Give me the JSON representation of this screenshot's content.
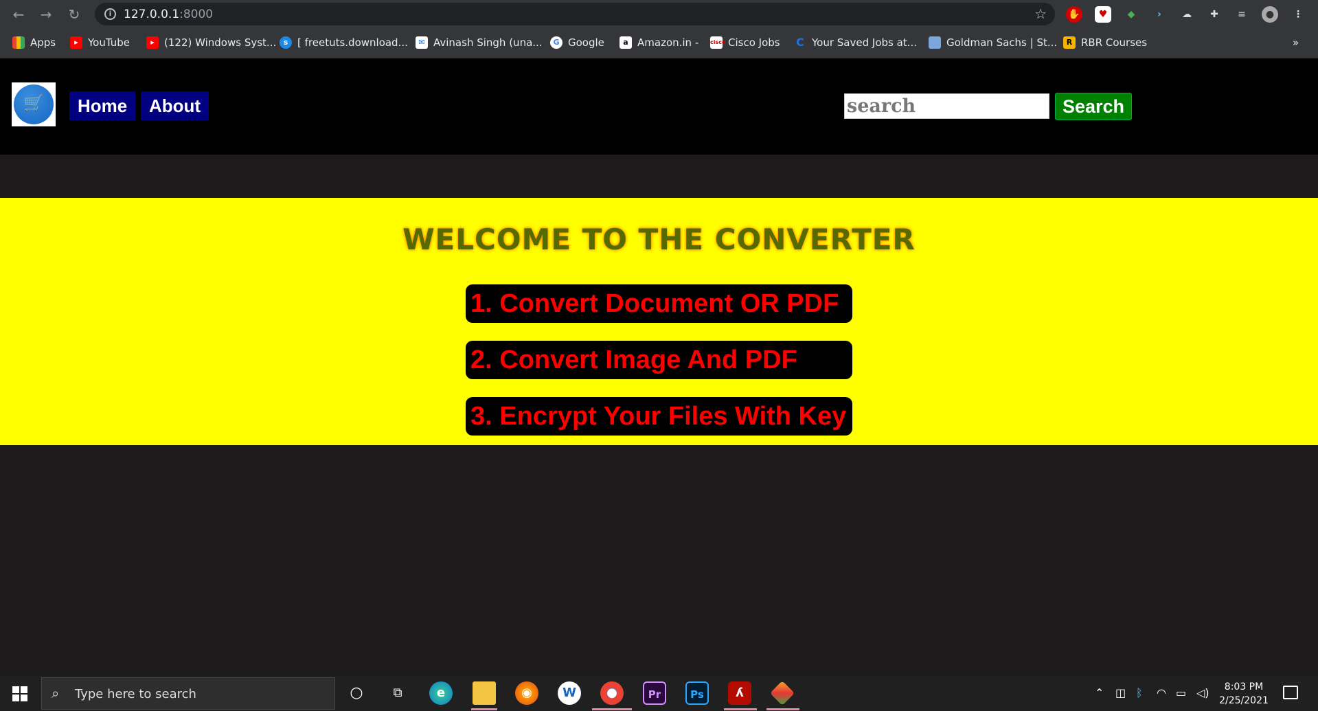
{
  "browser": {
    "url_host": "127.0.0.1",
    "url_port": ":8000",
    "bookmarks": [
      {
        "label": "Apps",
        "icon": "apps-grid-icon",
        "color": "#ea4335"
      },
      {
        "label": "YouTube",
        "icon": "youtube-icon",
        "color": "#ff0000"
      },
      {
        "label": "(122) Windows Syst...",
        "icon": "youtube-icon",
        "color": "#ff0000"
      },
      {
        "label": "[ freetuts.download...",
        "icon": "freetuts-icon",
        "color": "#1e88e5"
      },
      {
        "label": "Avinash Singh (una...",
        "icon": "mail-icon",
        "color": "#1a73e8"
      },
      {
        "label": "Google",
        "icon": "google-icon",
        "color": "#ffffff"
      },
      {
        "label": "Amazon.in -",
        "icon": "amazon-icon",
        "color": "#ffffff"
      },
      {
        "label": "Cisco Jobs",
        "icon": "cisco-icon",
        "color": "#ffffff"
      },
      {
        "label": "Your Saved Jobs at...",
        "icon": "c-icon",
        "color": "#ffffff"
      },
      {
        "label": "Goldman Sachs | St...",
        "icon": "page-icon",
        "color": "#7aa6d9"
      },
      {
        "label": "RBR Courses",
        "icon": "rbr-icon",
        "color": "#f4b400"
      }
    ],
    "overflow": "»"
  },
  "header": {
    "nav": [
      "Home",
      "About"
    ],
    "search_placeholder": "search",
    "search_button": "Search"
  },
  "banner": {
    "title": "WELCOME TO THE CONVERTER",
    "options": [
      "1. Convert Document OR PDF",
      "2. Convert Image And PDF",
      "3. Encrypt Your Files With Key"
    ]
  },
  "taskbar": {
    "search_placeholder": "Type here to search",
    "time": "8:03 PM",
    "date": "2/25/2021"
  }
}
